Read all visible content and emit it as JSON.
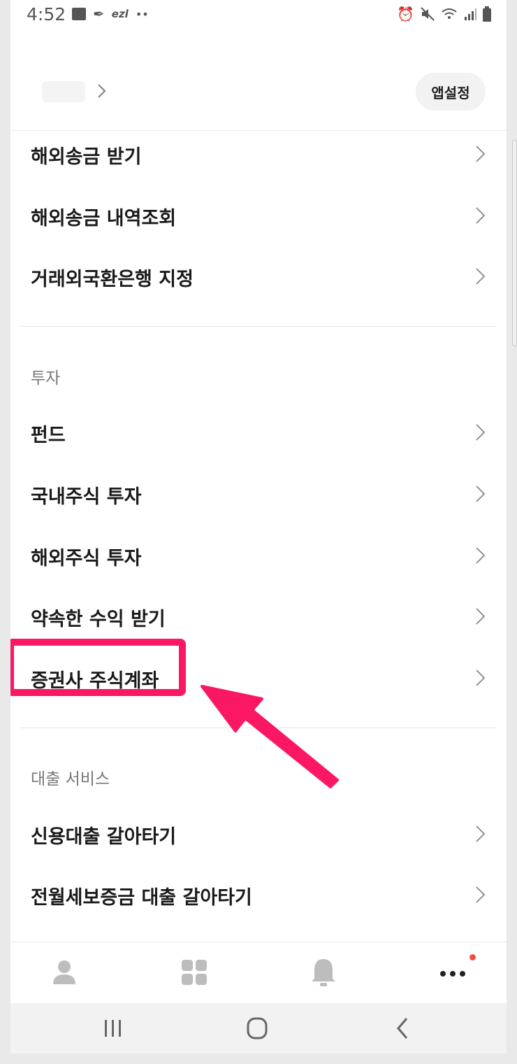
{
  "status_bar": {
    "time": "4:52",
    "carrier_text": "ezl",
    "dots": "••"
  },
  "header": {
    "app_settings_label": "앱설정"
  },
  "menu": {
    "items_top": [
      {
        "label": "해외송금 받기"
      },
      {
        "label": "해외송금 내역조회"
      },
      {
        "label": "거래외국환은행 지정"
      }
    ],
    "investment_section": {
      "title": "투자",
      "items": [
        {
          "label": "펀드"
        },
        {
          "label": "국내주식 투자"
        },
        {
          "label": "해외주식 투자"
        },
        {
          "label": "약속한 수익 받기"
        },
        {
          "label": "증권사 주식계좌"
        }
      ]
    },
    "loan_section": {
      "title": "대출 서비스",
      "items": [
        {
          "label": "신용대출 갈아타기"
        },
        {
          "label": "전월세보증금 대출 갈아타기"
        }
      ]
    }
  },
  "tab_bar": {
    "tabs": [
      {
        "icon": "person-icon"
      },
      {
        "icon": "grid-icon"
      },
      {
        "icon": "bell-icon"
      },
      {
        "icon": "more-icon",
        "has_badge": true
      }
    ]
  },
  "colors": {
    "highlight": "#fa1763",
    "badge": "#f24b3f"
  }
}
